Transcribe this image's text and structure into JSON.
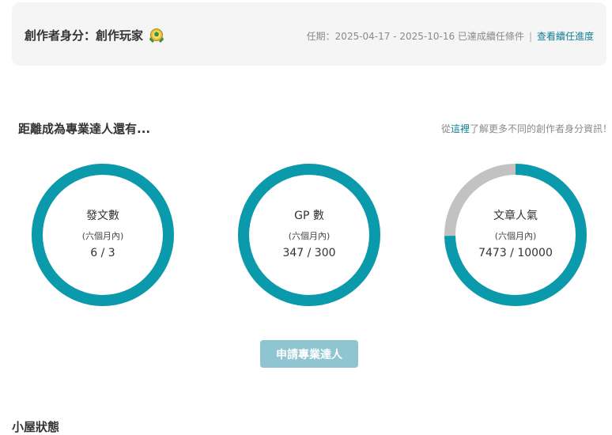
{
  "identity": {
    "title": "創作者身分：創作玩家",
    "badge_icon": "creator-badge-icon"
  },
  "term": {
    "text": "任期：2025-04-17 - 2025-10-16 已達成續任條件",
    "separator": "|",
    "link_label": "查看續任進度"
  },
  "progress_section": {
    "title": "距離成為專業達人還有...",
    "info_prefix": "從",
    "info_link": "這裡",
    "info_suffix": "了解更多不同的創作者身分資訊！"
  },
  "metrics": [
    {
      "label": "發文數",
      "sub": "(六個月內)",
      "value_text": "6 / 3",
      "current": 6,
      "target": 3
    },
    {
      "label": "GP 數",
      "sub": "(六個月內)",
      "value_text": "347 / 300",
      "current": 347,
      "target": 300
    },
    {
      "label": "文章人氣",
      "sub": "(六個月內)",
      "value_text": "7473 / 10000",
      "current": 7473,
      "target": 10000
    }
  ],
  "colors": {
    "ring_fill": "#0b9aab",
    "ring_track": "#c2c2c2",
    "accent_link": "#117e96",
    "button_bg": "#8ec5d0"
  },
  "apply_button": {
    "label": "申請專業達人"
  },
  "house_status": {
    "title": "小屋狀態"
  }
}
